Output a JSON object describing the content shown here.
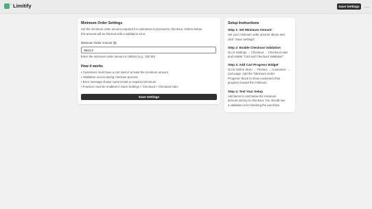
{
  "header": {
    "separator": "›",
    "app_name": "Limitify",
    "save_label": "Save Settings",
    "more_icon": "…"
  },
  "main": {
    "title": "Minimum Order Settings",
    "description_1": "Set the minimum order amount required for customers to proceed to checkout. Orders below",
    "description_2": "this amount will be blocked with a validation error.",
    "field_label": "Minimum Order Amount ($)",
    "field_value": "3624.0",
    "field_help": "Enter the minimum order amount in dollars (e.g., 100.00)",
    "how_title": "How it works",
    "bullets": [
      "• Customers must have a cart total of at least the minimum amount",
      "• Validation occurs during checkout process",
      "• Error message shows current total vs required minimum",
      "• Function must be enabled in Store Settings > Checkout > Checkout rules"
    ],
    "save_label": "Save Settings"
  },
  "setup": {
    "title": "Setup Instructions",
    "steps": [
      {
        "title": "Step 1: Set Minimum Amount",
        "lines": [
          "Set your minimum order amount above and",
          "click \"Save Settings\""
        ]
      },
      {
        "title": "Step 2: Enable Checkout Validation",
        "lines": [
          "Go to Settings → Checkout → Checkout rules",
          "and enable \"Cart and Checkout Validation\""
        ]
      },
      {
        "title": "Step 3: Add Cart Progress Widget",
        "lines": [
          "Go to Online Store → Themes → Customize →",
          "Cart page. Add the \"Minimum Order",
          "Progress\" block to show customers their",
          "progress toward the minimum."
        ]
      },
      {
        "title": "Step 4: Test Your Setup",
        "lines": [
          "Add items to cart below the minimum",
          "amount and try to checkout. You should see",
          "a validation error blocking the purchase."
        ]
      }
    ]
  }
}
